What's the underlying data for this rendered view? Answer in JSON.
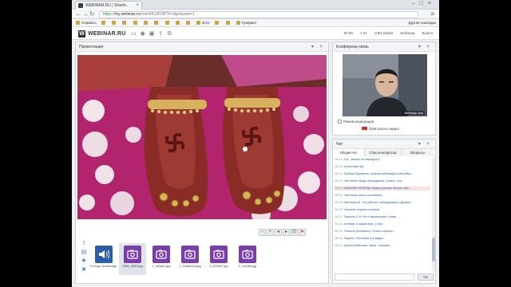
{
  "browser": {
    "tab_title": "WEBINAR.RU | Sharin...",
    "url_secure": "https://",
    "url_main": "my.webinar.ru",
    "url_rest": "/event/613638/?t=1&prepare=1",
    "bookmarks_left": [
      "Сервисы",
      "",
      "",
      "",
      "",
      "",
      "",
      "",
      "",
      "",
      "Блог",
      "",
      "",
      "",
      "",
      "Графики",
      "",
      ""
    ],
    "bookmarks_right": "Другие закладки"
  },
  "app": {
    "logo_letter": "W",
    "logo_text": "WEBINAR.RU",
    "head_right": [
      "50:00",
      "1 Ю",
      "1001 Юрий",
      "Вебинар",
      "Выйти"
    ]
  },
  "presentation": {
    "panel_title": "Презентация",
    "thumbnails": [
      {
        "label": "01 Ilogo-knowledge...",
        "kind": "audio"
      },
      {
        "label": "Slide_0349.jpg",
        "kind": "image"
      },
      {
        "label": "1_4e0ab1.jpg",
        "kind": "image"
      },
      {
        "label": "1_04e8b31d.jpg",
        "kind": "image"
      },
      {
        "label": "0_573467.jpg",
        "kind": "image"
      },
      {
        "label": "0_1e2d0f.jpg",
        "kind": "image"
      }
    ]
  },
  "conference": {
    "panel_title": "Конференц-связь",
    "mode_label": "Режим модерации",
    "invite_label": "Пригласить видео",
    "name_tag": "Вебинар Бэк"
  },
  "chat": {
    "panel_title": "Чат",
    "tabs": [
      "Общий чат",
      "Список вопросов",
      "Вопросы"
    ],
    "send_label": "Ок",
    "messages": [
      {
        "time": "10:13",
        "text": "А.В., можно не выходить?"
      },
      {
        "time": "10:13",
        "text": "А.Киселёв: Да"
      },
      {
        "time": "10:13",
        "text": "Любовь Бурякина: хочется вебинара в сентябре"
      },
      {
        "time": "10:13",
        "text": "Светлана: Выдо обсуждение: ничего, это..."
      },
      {
        "time": "10:13",
        "text": "НАТАЛЬЯ ЗЕЛЕНА: Видео решить вопрос нас..."
      },
      {
        "time": "10:13",
        "text": "Светлана: вся в состоянии..."
      },
      {
        "time": "10:13",
        "text": "Светлана В.: Не работа с женщинами в Дунине..."
      },
      {
        "time": "10:13",
        "text": "Татьяна: хорошо сказали"
      },
      {
        "time": "10:13",
        "text": "Татьяна С-Н: Не в заключение слово..."
      },
      {
        "time": "10:13",
        "text": "сетевая: а какие вкус, у нас..."
      },
      {
        "time": "10:13",
        "text": "Татьяна (Ильиных): Очень хорошо..."
      },
      {
        "time": "10:13",
        "text": "Ларисо: Настасия это видео..."
      },
      {
        "time": "10:13",
        "text": "Ирина Небесные Чаны: Человек..."
      }
    ]
  },
  "colors": {
    "accent": "#d8302f",
    "link": "#1d5fa8",
    "panel_border": "#cdd2d8"
  }
}
